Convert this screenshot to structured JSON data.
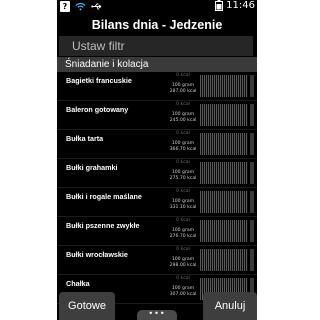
{
  "status_bar": {
    "help_icon_glyph": "?",
    "time": "11:46",
    "icons": [
      "help-icon",
      "wifi-icon",
      "usb-icon",
      "battery-icon"
    ]
  },
  "title": "Bilans dnia - Jedzenie",
  "filter": {
    "placeholder": "Ustaw filtr",
    "value": ""
  },
  "section": {
    "label": "Śniadanie i kolacja"
  },
  "items": [
    {
      "name": "Bagietki francuskie",
      "kcal_top": "0 kcal",
      "grams": "100 gram",
      "kcal": "287.00 kcal"
    },
    {
      "name": "Baleron gotowany",
      "kcal_top": "0 kcal",
      "grams": "100 gram",
      "kcal": "245.00 kcal"
    },
    {
      "name": "Bułka tarta",
      "kcal_top": "0 kcal",
      "grams": "100 gram",
      "kcal": "366.70 kcal"
    },
    {
      "name": "Bułki grahamki",
      "kcal_top": "0 kcal",
      "grams": "100 gram",
      "kcal": "275.70 kcal"
    },
    {
      "name": "Bułki i rogale maślane",
      "kcal_top": "0 kcal",
      "grams": "100 gram",
      "kcal": "331.10 kcal"
    },
    {
      "name": "Bułki pszenne zwykłe",
      "kcal_top": "0 kcal",
      "grams": "100 gram",
      "kcal": "276.70 kcal"
    },
    {
      "name": "Bułki wrocławskie",
      "kcal_top": "0 kcal",
      "grams": "100 gram",
      "kcal": "298.00 kcal"
    },
    {
      "name": "Chałka",
      "kcal_top": "0 kcal",
      "grams": "100 gram",
      "kcal": "307.00 kcal"
    }
  ],
  "buttons": {
    "done": "Gotowe",
    "cancel": "Anuluj",
    "more": "•••"
  }
}
